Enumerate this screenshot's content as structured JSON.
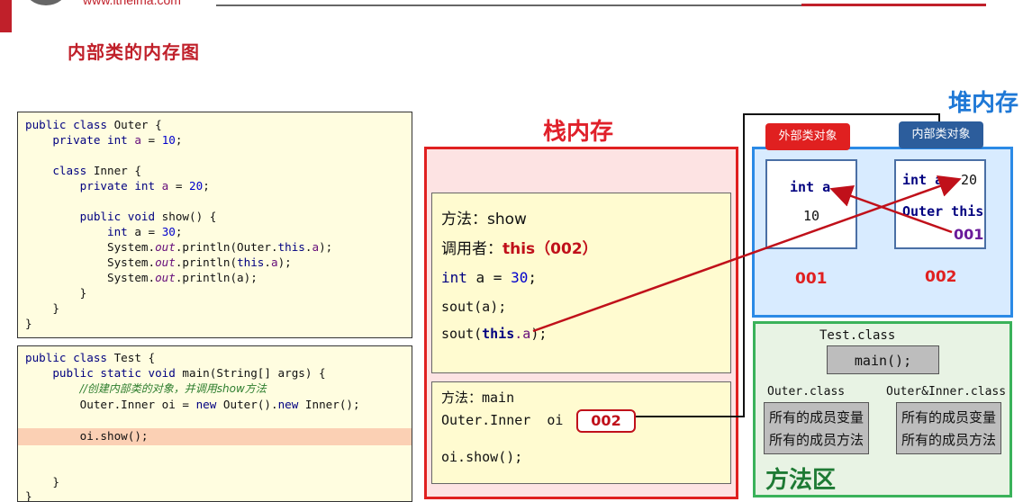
{
  "header": {
    "url": "www.itheima.com",
    "title": "内部类的内存图"
  },
  "code_outer": [
    "public class Outer {",
    "    private int a = 10;",
    "",
    "    class Inner {",
    "        private int a = 20;",
    "",
    "        public void show() {",
    "            int a = 30;",
    "            System.out.println(Outer.this.a);",
    "            System.out.println(this.a);",
    "            System.out.println(a);",
    "        }",
    "    }",
    "}"
  ],
  "code_test": {
    "l1": "public class Test {",
    "l2": "    public static void main(String[] args) {",
    "comment": "//创建内部类的对象，并调用show方法",
    "l4": "        Outer.Inner oi = new Outer().new Inner();",
    "l5": "        oi.show();",
    "l6": "    }",
    "l7": "}"
  },
  "stack": {
    "title": "栈内存",
    "show_frame": {
      "method_label": "方法：show",
      "caller_label": "调用者：",
      "caller_value": "this（002）",
      "local_decl_kw": "int",
      "local_decl_rest": " a = ",
      "local_decl_num": "30",
      "local_decl_end": ";",
      "sout_a_pre": "sout(",
      "sout_a_var": "a",
      "sout_a_post": ");",
      "sout_this_pre": "sout(",
      "sout_this_kw": "this",
      "sout_this_var": ".a",
      "sout_this_post": ");"
    },
    "main_frame": {
      "method_label": "方法：main",
      "var_decl": "Outer.Inner  oi",
      "var_ref": "002",
      "call": "oi.show();"
    }
  },
  "heap": {
    "title": "堆内存",
    "outer_tag": "外部类对象",
    "inner_tag": "内部类对象",
    "outer_obj": {
      "field": "int a",
      "value": "10",
      "address": "001"
    },
    "inner_obj": {
      "field": "int a",
      "value": "20",
      "outer_this_label": "Outer this",
      "outer_this_value": "001",
      "address": "002"
    }
  },
  "method_area": {
    "title": "方法区",
    "test_class": "Test.class",
    "main_method": "main();",
    "outer_class": "Outer.class",
    "outer_inner_class": "Outer&Inner.class",
    "members_vars": "所有的成员变量",
    "members_methods": "所有的成员方法"
  },
  "colors": {
    "accent_red": "#e02020",
    "accent_blue": "#2b8ae6",
    "accent_green": "#3ab25a"
  }
}
